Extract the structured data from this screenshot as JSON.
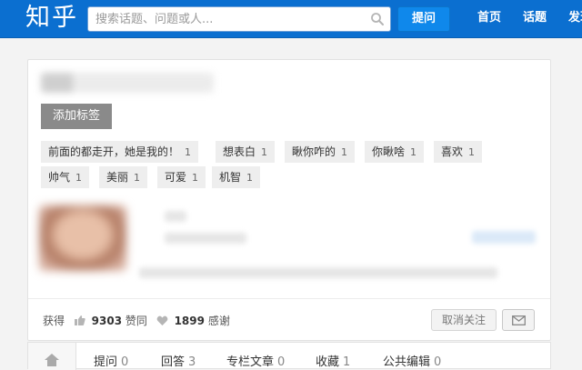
{
  "header": {
    "logo": "知乎",
    "search_placeholder": "搜索话题、问题或人...",
    "ask_label": "提问",
    "nav": [
      "首页",
      "话题",
      "发现"
    ]
  },
  "profile": {
    "add_tag_label": "添加标签",
    "tags": [
      {
        "label": "前面的都走开，她是我的！",
        "count": "1"
      },
      {
        "label": "想表白",
        "count": "1"
      },
      {
        "label": "瞅你咋的",
        "count": "1"
      },
      {
        "label": "你瞅啥",
        "count": "1"
      },
      {
        "label": "喜欢",
        "count": "1"
      },
      {
        "label": "帅气",
        "count": "1"
      },
      {
        "label": "美丽",
        "count": "1"
      },
      {
        "label": "可爱",
        "count": "1"
      },
      {
        "label": "机智",
        "count": "1"
      }
    ],
    "stats": {
      "prefix": "获得",
      "upvotes": "9303",
      "upvotes_label": "赞同",
      "thanks": "1899",
      "thanks_label": "感谢"
    },
    "unfollow_label": "取消关注"
  },
  "tabs": [
    {
      "label": "提问",
      "count": "0"
    },
    {
      "label": "回答",
      "count": "3"
    },
    {
      "label": "专栏文章",
      "count": "0"
    },
    {
      "label": "收藏",
      "count": "1"
    },
    {
      "label": "公共编辑",
      "count": "0"
    }
  ]
}
